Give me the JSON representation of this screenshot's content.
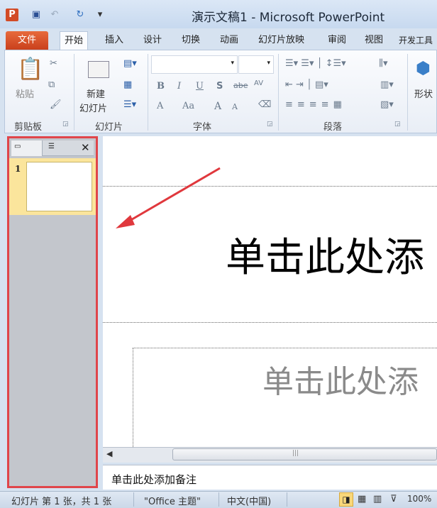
{
  "window": {
    "title": "演示文稿1 - Microsoft PowerPoint"
  },
  "quick_access": {
    "app_icon": "P",
    "save": "save-icon",
    "undo": "undo-icon",
    "redo": "redo-icon",
    "customize": "▾"
  },
  "tabs": [
    "文件",
    "开始",
    "插入",
    "设计",
    "切换",
    "动画",
    "幻灯片放映",
    "审阅",
    "视图",
    "开发工具"
  ],
  "ribbon": {
    "clipboard": {
      "paste": "粘贴",
      "group": "剪贴板"
    },
    "slides": {
      "new_slide_line1": "新建",
      "new_slide_line2": "幻灯片",
      "group": "幻灯片"
    },
    "font": {
      "font_name": "",
      "font_size": "",
      "bold": "B",
      "italic": "I",
      "underline": "U",
      "shadow": "S",
      "strike": "abe",
      "spacing": "AV",
      "color": "A",
      "case": "Aa",
      "grow": "A",
      "shrink": "A",
      "group": "字体"
    },
    "paragraph": {
      "group": "段落"
    },
    "drawing": {
      "shapes": "形状"
    }
  },
  "slide_panel": {
    "slide_number": "1"
  },
  "slide": {
    "title_placeholder": "单击此处添",
    "subtitle_placeholder": "单击此处添"
  },
  "notes": {
    "placeholder": "单击此处添加备注"
  },
  "status": {
    "slide_info": "幻灯片 第 1 张，共 1 张",
    "theme": "\"Office 主题\"",
    "language": "中文(中国)",
    "zoom": "100%"
  },
  "colors": {
    "highlight": "#e0454a",
    "file_tab": "#d4502a"
  }
}
